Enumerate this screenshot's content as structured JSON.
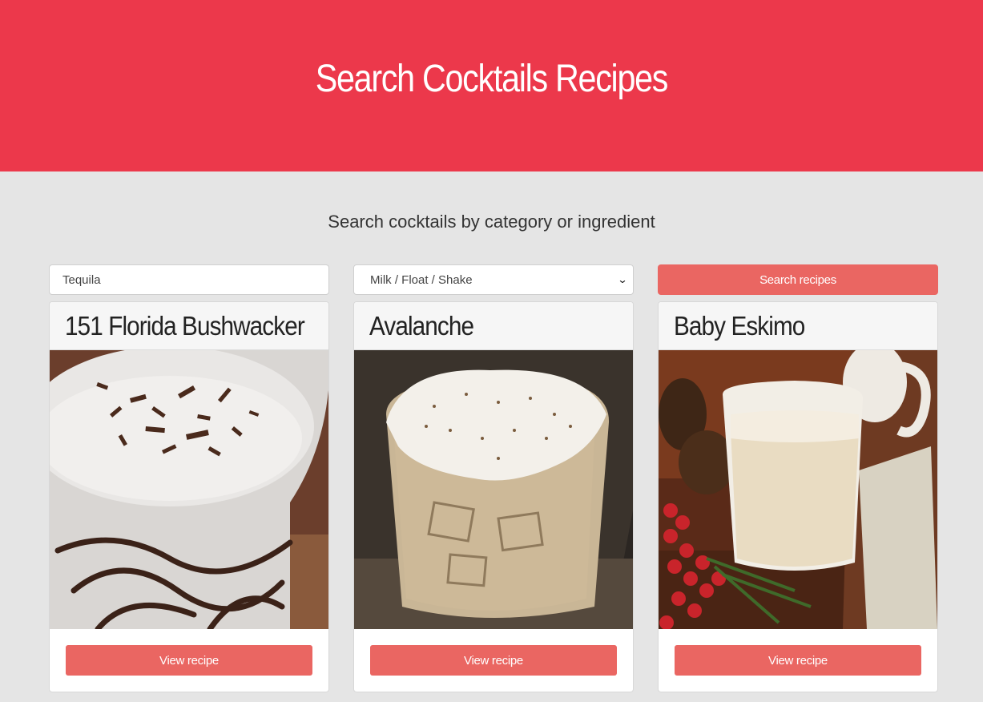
{
  "header": {
    "title": "Search Cocktails Recipes",
    "brand_color": "#ec384b"
  },
  "search": {
    "subtitle": "Search cocktails by category or ingredient",
    "ingredient_value": "Tequila",
    "category_selected": "Milk / Float / Shake",
    "button_label": "Search recipes",
    "button_color": "#ea6662"
  },
  "cards": [
    {
      "title": "151 Florida Bushwacker",
      "button_label": "View recipe",
      "image": "bushwacker-photo"
    },
    {
      "title": "Avalanche",
      "button_label": "View recipe",
      "image": "avalanche-photo"
    },
    {
      "title": "Baby Eskimo",
      "button_label": "View recipe",
      "image": "baby-eskimo-photo"
    }
  ],
  "icons": {
    "select_arrow": "chevron-down-icon"
  }
}
